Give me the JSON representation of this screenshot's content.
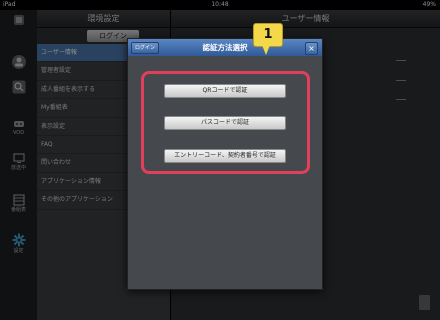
{
  "status_bar": {
    "device": "iPad",
    "time": "10:48",
    "battery": "49%"
  },
  "icon_bar": {
    "items": [
      {
        "name": "menu-icon",
        "label": ""
      },
      {
        "name": "user-icon",
        "label": ""
      },
      {
        "name": "search-icon",
        "label": ""
      },
      {
        "name": "vod-icon",
        "label": "VOD"
      },
      {
        "name": "broadcast-icon",
        "label": "放送中"
      },
      {
        "name": "program-guide-icon",
        "label": "番組表"
      },
      {
        "name": "settings-icon",
        "label": "設定"
      }
    ]
  },
  "left_panel": {
    "title": "環境設定",
    "login_label": "ログイン",
    "items": [
      {
        "label": "ユーザー情報",
        "selected": true
      },
      {
        "label": "管理者設定"
      },
      {
        "label": "成人番組を表示する"
      },
      {
        "label": "My番組表"
      },
      {
        "label": "表示設定"
      },
      {
        "label": "FAQ"
      },
      {
        "label": "問い合わせ"
      },
      {
        "label": "アプリケーション情報"
      },
      {
        "label": "その他のアプリケーション"
      }
    ]
  },
  "right_panel": {
    "title": "ユーザー情報"
  },
  "modal": {
    "title": "認証方法選択",
    "login_label": "ログイン",
    "close_label": "×",
    "buttons": [
      {
        "label": "QRコードで認証"
      },
      {
        "label": "パスコードで認証"
      },
      {
        "label": "エントリーコード、契約者番号で認証"
      }
    ]
  },
  "annotation": {
    "badge": "1",
    "highlight_color": "#e2405a",
    "badge_color": "#f3d84a"
  },
  "colors": {
    "accent": "#4a78b0",
    "modal_header": "#3f6dab"
  }
}
